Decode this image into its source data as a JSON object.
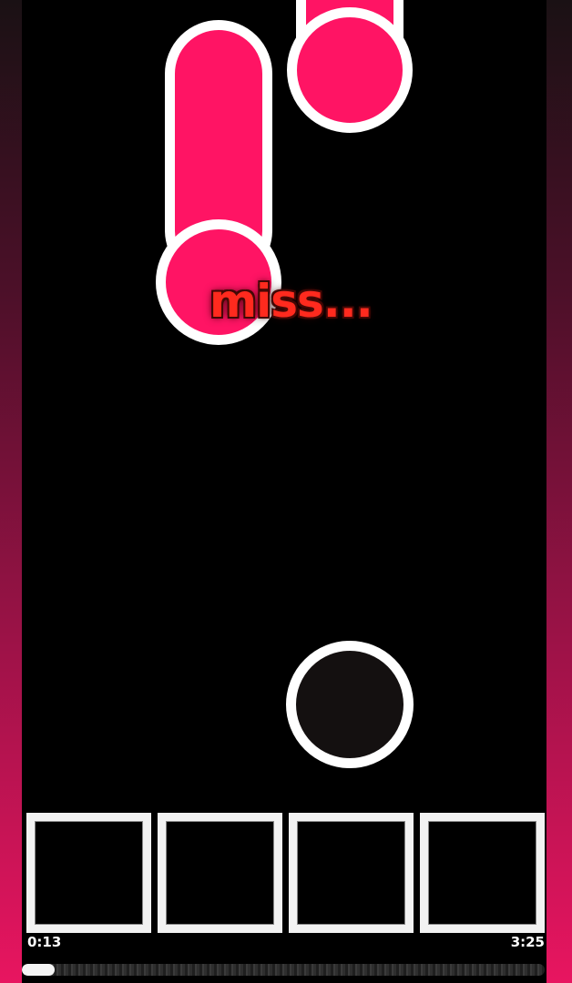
{
  "judgement": {
    "text": "miss..."
  },
  "song_time": {
    "current": "0:13",
    "total": "3:25"
  },
  "progress": {
    "fraction": 0.063
  },
  "lanes": [
    {
      "name": "lane-1"
    },
    {
      "name": "lane-2"
    },
    {
      "name": "lane-3"
    },
    {
      "name": "lane-4"
    }
  ],
  "colors": {
    "note": "#ff1464",
    "outline": "#ffffff",
    "miss_text": "#ff2a1e",
    "background": "#000000",
    "side_gradient_bottom": "#e81560"
  }
}
